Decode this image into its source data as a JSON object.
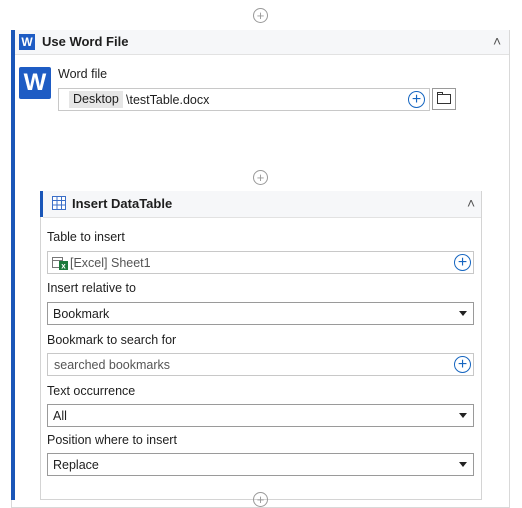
{
  "outer_activity": {
    "badge": "W",
    "title": "Use Word File",
    "word_file_label": "Word file",
    "path_chip": "Desktop",
    "path_value": "\\testTable.docx"
  },
  "inner_activity": {
    "title": "Insert DataTable",
    "table_to_insert": {
      "label": "Table to insert",
      "value": "[Excel] Sheet1"
    },
    "insert_relative_to": {
      "label": "Insert relative to",
      "value": "Bookmark"
    },
    "bookmark_to_search": {
      "label": "Bookmark to search for",
      "value": "searched bookmarks"
    },
    "text_occurrence": {
      "label": "Text occurrence",
      "value": "All"
    },
    "position_where": {
      "label": "Position where to insert",
      "value": "Replace"
    }
  },
  "glyphs": {
    "plus": "+",
    "chevron_up": "˄"
  },
  "colors": {
    "accent": "#1a56b8",
    "word_badge": "#1e5cc4",
    "excel_green": "#1d7a3d"
  }
}
